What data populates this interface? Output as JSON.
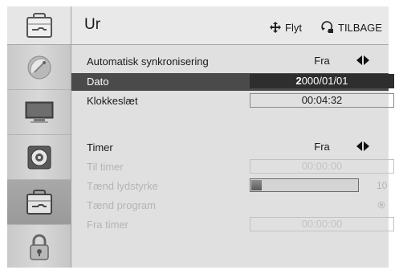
{
  "header": {
    "title": "Ur",
    "move_hint": "Flyt",
    "back_hint": "TILBAGE"
  },
  "sidebar": {
    "items": [
      {
        "icon": "setup-toolbox-icon"
      },
      {
        "icon": "satellite-dish-icon"
      },
      {
        "icon": "monitor-icon"
      },
      {
        "icon": "speaker-icon"
      },
      {
        "icon": "setup-toolbox-icon",
        "active": true
      },
      {
        "icon": "lock-icon"
      }
    ]
  },
  "settings": {
    "auto_sync": {
      "label": "Automatisk synkronisering",
      "value": "Fra"
    },
    "date": {
      "label": "Dato",
      "value_cursor": "2",
      "value_rest": "000/01/01"
    },
    "clock": {
      "label": "Klokkeslæt",
      "value": "00:04:32"
    },
    "timer": {
      "label": "Timer",
      "value": "Fra"
    },
    "on_time": {
      "label": "Til timer",
      "value": "00:00:00"
    },
    "on_volume": {
      "label": "Tænd lydstyrke",
      "value": 10
    },
    "on_program": {
      "label": "Tænd program"
    },
    "off_time": {
      "label": "Fra timer",
      "value": "00:00:00"
    }
  },
  "colors": {
    "selected_row": "#4a4a4a",
    "disabled_text": "#b4b4b4"
  }
}
